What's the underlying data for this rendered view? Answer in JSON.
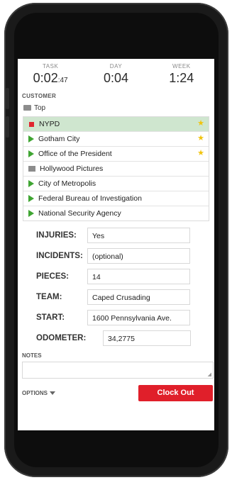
{
  "timers": [
    {
      "label": "TASK",
      "main": "0:02",
      "sub": ":47"
    },
    {
      "label": "DAY",
      "main": "0:04",
      "sub": ""
    },
    {
      "label": "WEEK",
      "main": "1:24",
      "sub": ""
    }
  ],
  "customer": {
    "label": "CUSTOMER",
    "top_label": "Top",
    "items": [
      {
        "label": "NYPD",
        "icon": "red-square-icon",
        "starred": true,
        "selected": true
      },
      {
        "label": "Gotham City",
        "icon": "triangle-right-icon",
        "starred": true
      },
      {
        "label": "Office of the President",
        "icon": "triangle-right-icon",
        "starred": true
      },
      {
        "label": "Hollywood Pictures",
        "icon": "folder-icon",
        "starred": false
      },
      {
        "label": "City of Metropolis",
        "icon": "triangle-right-icon",
        "starred": false
      },
      {
        "label": "Federal Bureau of Investigation",
        "icon": "triangle-right-icon",
        "starred": false
      },
      {
        "label": "National Security Agency",
        "icon": "triangle-right-icon",
        "starred": false
      }
    ],
    "star_glyph": "★"
  },
  "form": {
    "injuries": {
      "label": "INJURIES:",
      "value": "Yes"
    },
    "incidents": {
      "label": "INCIDENTS:",
      "value": "(optional)"
    },
    "pieces": {
      "label": "PIECES:",
      "value": "14"
    },
    "team": {
      "label": "TEAM:",
      "value": "Caped Crusading"
    },
    "start": {
      "label": "START:",
      "value": "1600 Pennsylvania Ave."
    },
    "odometer": {
      "label": "ODOMETER:",
      "value": "34,2775"
    }
  },
  "notes": {
    "label": "NOTES",
    "value": ""
  },
  "options_label": "OPTIONS",
  "clock_out_label": "Clock Out",
  "colors": {
    "accent_red": "#e01f2a",
    "selected_row": "#cfe6cf",
    "star": "#f1c40f",
    "arrow_green": "#3fa532"
  }
}
